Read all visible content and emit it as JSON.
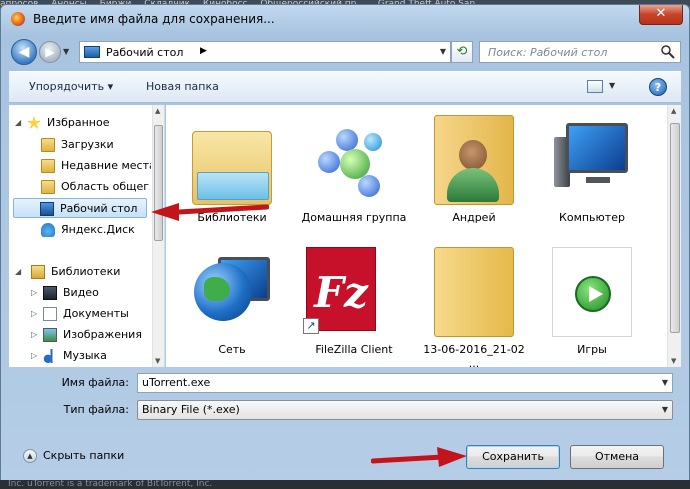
{
  "browser": {
    "bookmarks": [
      "апросов",
      "Анонсы",
      "Биржи",
      "Складчик",
      "Кинобосс",
      "Общероссийский пр...",
      "Grand Theft Auto San..."
    ],
    "footer": "Inc. uTorrent is a trademark of BitTorrent, Inc."
  },
  "dialog": {
    "title": "Введите имя файла для сохранения...",
    "close_label": "✕"
  },
  "address": {
    "path": "Рабочий стол",
    "search_placeholder": "Поиск: Рабочий стол"
  },
  "toolbar": {
    "organize": "Упорядочить ▾",
    "new_folder": "Новая папка",
    "help": "?"
  },
  "nav": {
    "favorites": "Избранное",
    "downloads": "Загрузки",
    "recent": "Недавние места",
    "shared": "Область общег",
    "desktop": "Рабочий стол",
    "yandex": "Яндекс.Диск",
    "libraries": "Библиотеки",
    "video": "Видео",
    "documents": "Документы",
    "images": "Изображения",
    "music": "Музыка"
  },
  "items": [
    {
      "label": "Библиотеки"
    },
    {
      "label": "Домашняя группа"
    },
    {
      "label": "Андрей"
    },
    {
      "label": "Компьютер"
    },
    {
      "label": "Сеть"
    },
    {
      "label": "FileZilla Client"
    },
    {
      "label": "13-06-2016_21-02 ..."
    },
    {
      "label": "Игры"
    }
  ],
  "fields": {
    "filename_label": "Имя файла:",
    "filename_value": "uTorrent.exe",
    "filetype_label": "Тип файла:",
    "filetype_value": "Binary File (*.exe)"
  },
  "buttons": {
    "hide_folders": "Скрыть папки",
    "save": "Сохранить",
    "cancel": "Отмена"
  },
  "colors": {
    "annotation_arrow": "#c3141b",
    "accent": "#3c7fb1"
  }
}
